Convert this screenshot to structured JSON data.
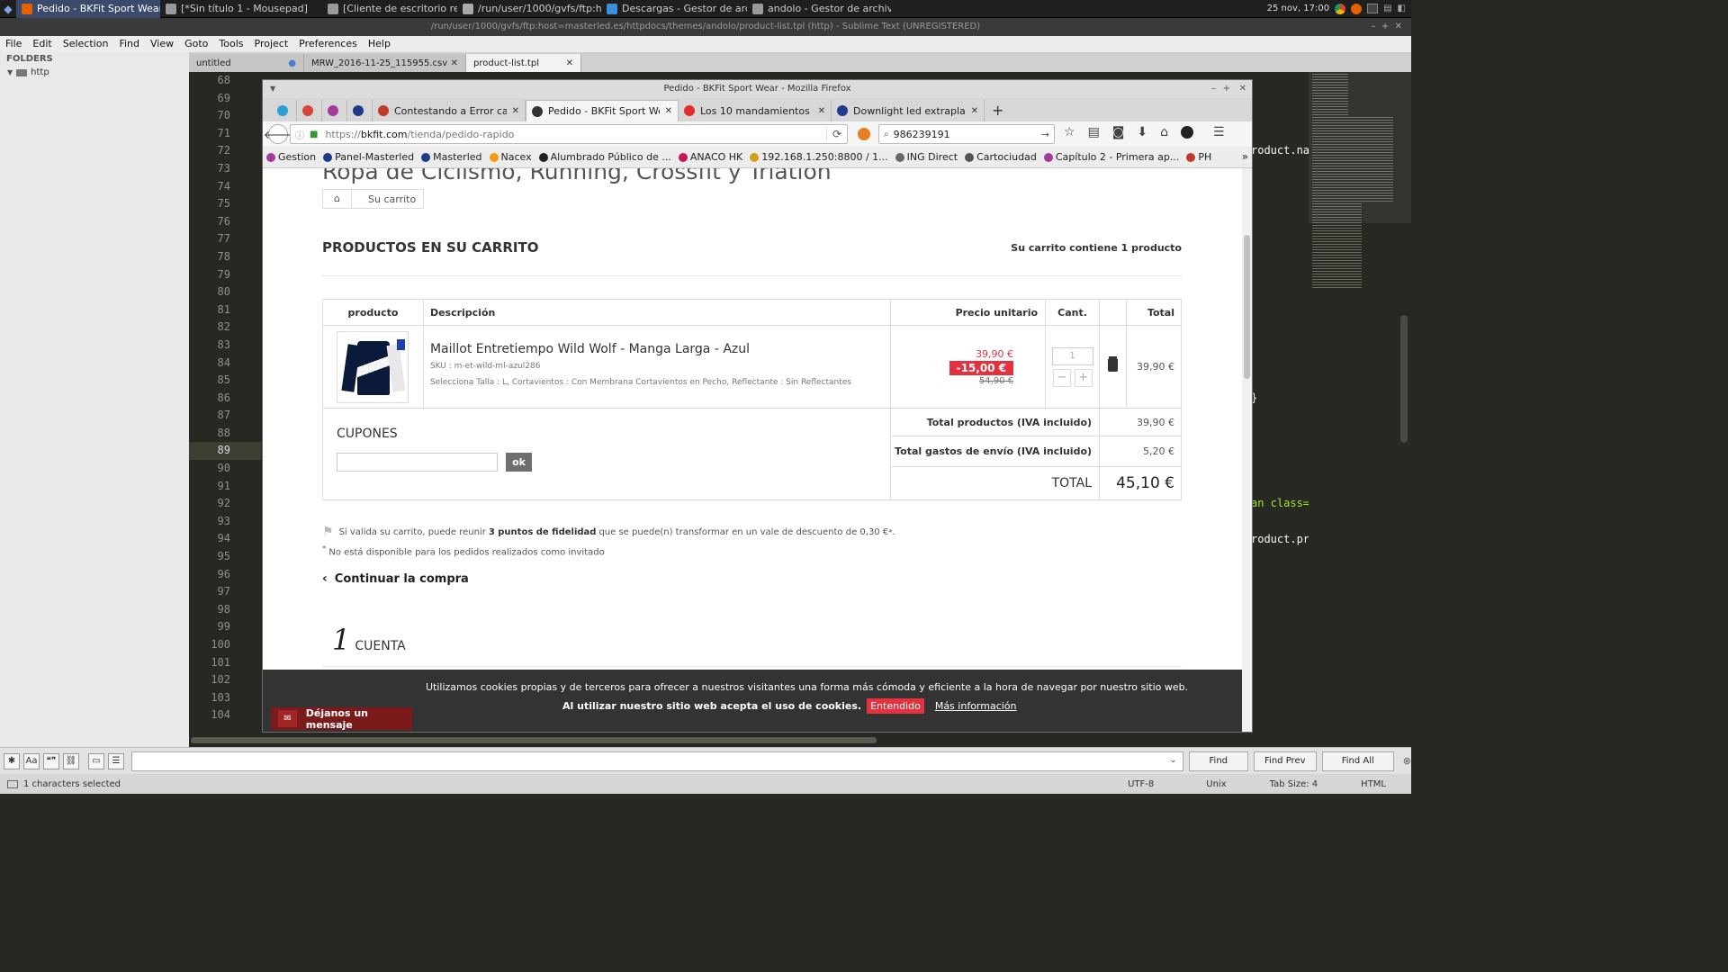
{
  "taskbar": {
    "tasks": [
      {
        "label": "Pedido - BKFit Sport Wear ...",
        "icon": "firefox-icon",
        "color": "#e66000",
        "active": true
      },
      {
        "label": "[*Sin título 1 - Mousepad]",
        "icon": "editor-icon",
        "color": "#999999"
      },
      {
        "label": "[Cliente de escritorio remo...",
        "icon": "remote-desktop-icon",
        "color": "#999999"
      },
      {
        "label": "/run/user/1000/gvfs/ftp:h...",
        "icon": "terminal-icon",
        "color": "#aaaaaa"
      },
      {
        "label": "Descargas - Gestor de arch...",
        "icon": "download-icon",
        "color": "#3c8dde"
      },
      {
        "label": "andolo - Gestor de archivos",
        "icon": "folder-icon",
        "color": "#999999"
      }
    ],
    "clock": "25 nov, 17:00"
  },
  "sublime": {
    "title": "/run/user/1000/gvfs/ftp:host=masterled.es/httpdocs/themes/andolo/product-list.tpl (http) - Sublime Text (UNREGISTERED)",
    "menu": [
      "File",
      "Edit",
      "Selection",
      "Find",
      "View",
      "Goto",
      "Tools",
      "Project",
      "Preferences",
      "Help"
    ],
    "sidebar": {
      "heading": "FOLDERS",
      "folder": "http"
    },
    "tabs": [
      {
        "label": "untitled",
        "mark": "●"
      },
      {
        "label": "MRW_2016-11-25_115955.csv",
        "mark": "✕"
      },
      {
        "label": "product-list.tpl",
        "mark": "✕"
      }
    ],
    "line_numbers": [
      "68",
      "69",
      "70",
      "71",
      "72",
      "73",
      "74",
      "75",
      "76",
      "77",
      "78",
      "79",
      "80",
      "81",
      "82",
      "83",
      "84",
      "85",
      "86",
      "87",
      "88",
      "89",
      "90",
      "91",
      "92",
      "93",
      "94",
      "95",
      "96",
      "97",
      "98",
      "99",
      "100",
      "101",
      "102",
      "103",
      "104"
    ],
    "current_line": "89",
    "code_fragments": [
      {
        "text": "roduct.nan",
        "line": "72"
      },
      {
        "text": "}",
        "line": "86"
      },
      {
        "text": "an class=\"",
        "line": "92"
      },
      {
        "text": "roduct.pric",
        "line": "94"
      }
    ],
    "find": {
      "toggles": [
        "✱",
        "Aa",
        "❝❞",
        "⛓",
        "▭",
        "☰"
      ],
      "buttons": [
        "Find",
        "Find Prev",
        "Find All"
      ]
    },
    "status": {
      "left": "1 characters selected",
      "encoding": "UTF-8",
      "line_endings": "Unix",
      "tab_size": "Tab Size: 4",
      "syntax": "HTML"
    }
  },
  "firefox": {
    "window_title": "Pedido - BKFit Sport Wear - Mozilla Firefox",
    "tabs": [
      {
        "label": "",
        "icon": "pinned-chat-icon",
        "color": "#2a9fd6"
      },
      {
        "label": "",
        "icon": "gmail-icon",
        "color": "#d44638"
      },
      {
        "label": "",
        "icon": "opera-icon",
        "color": "#a33a9c"
      },
      {
        "label": "",
        "icon": "masterled-icon",
        "color": "#1e3a8a"
      },
      {
        "label": "Contestando a Error cal...",
        "icon": "forum-icon",
        "color": "#c0392b"
      },
      {
        "label": "Pedido - BKFit Sport We...",
        "icon": "bkfit-icon",
        "color": "#333333",
        "current": true
      },
      {
        "label": "Los 10 mandamientos ...",
        "icon": "red-circle-icon",
        "color": "#e32b2b"
      },
      {
        "label": "Downlight led extrapla...",
        "icon": "masterled-icon",
        "color": "#1e3a8a"
      }
    ],
    "url": {
      "prefix": "https://",
      "host": "bkfit.com",
      "path": "/tienda/pedido-rapido"
    },
    "search_value": "986239191",
    "bookmarks": [
      {
        "label": "Gestion",
        "color": "#a33a9c"
      },
      {
        "label": "Panel-Masterled",
        "color": "#1e3a8a"
      },
      {
        "label": "Masterled",
        "color": "#1e3a8a"
      },
      {
        "label": "Nacex",
        "color": "#f39c12"
      },
      {
        "label": "Alumbrado Público de ...",
        "color": "#222222"
      },
      {
        "label": "ANACO HK",
        "color": "#c2185b"
      },
      {
        "label": "192.168.1.250:8800 / 1...",
        "color": "#d4a017"
      },
      {
        "label": "ING Direct",
        "color": "#666666"
      },
      {
        "label": "Cartociudad",
        "color": "#555555"
      },
      {
        "label": "Capítulo 2 - Primera ap...",
        "color": "#a33a9c"
      },
      {
        "label": "PH",
        "color": "#c0392b"
      }
    ],
    "overflow": "»"
  },
  "page": {
    "heading": "Ropa de Ciclismo, Running, Crossfit y Triatlón",
    "breadcrumb": "Su carrito",
    "cart_title": "PRODUCTOS EN SU CARRITO",
    "cart_count": "Su carrito contiene 1 producto",
    "columns": [
      "producto",
      "Descripción",
      "Precio unitario",
      "Cant.",
      "Total"
    ],
    "product": {
      "name": "Maillot Entretiempo Wild Wolf - Manga Larga - Azul",
      "sku": "SKU : m-et-wild-ml-azul286",
      "options": "Selecciona Talla : L, Cortavientos : Con Membrana Cortavientos en Pecho, Reflectante : Sin Reflectantes",
      "price": "39,90 €",
      "discount": "-15,00 €",
      "old_price": "54,90 €",
      "qty": "1",
      "total": "39,90 €"
    },
    "coupons": {
      "title": "CUPONES",
      "ok": "ok"
    },
    "totals": [
      {
        "label": "Total productos (IVA incluido)",
        "value": "39,90 €"
      },
      {
        "label": "Total gastos de envío (IVA incluido)",
        "value": "5,20 €"
      }
    ],
    "grand_total": {
      "label": "TOTAL",
      "value": "45,10 €"
    },
    "loyalty": {
      "before": "Si valida su carrito, puede reunir ",
      "points": "3 puntos de fidelidad",
      "after": " que se puede(n) transformar en un vale de descuento de 0,30 €",
      "star": "*",
      "period": "."
    },
    "loyalty_note": "No está disponible para los pedidos realizados como invitado",
    "continue": "Continuar la compra",
    "step": {
      "number": "1",
      "label": "CUENTA"
    },
    "cookie": {
      "line1": "Utilizamos cookies propias y de terceros para ofrecer a nuestros visitantes una forma más cómoda y eficiente a la hora de navegar por nuestro sitio web.",
      "line2": "Al utilizar nuestro sitio web acepta el uso de cookies.",
      "accept": "Entendido",
      "more": "Más información"
    },
    "message_button": "Déjanos un mensaje"
  },
  "colors": {
    "accent_red": "#e5303f",
    "discount_bg": "#e5303f",
    "cookie_bg": "#333333",
    "msg_bg": "#7a1a1a"
  }
}
